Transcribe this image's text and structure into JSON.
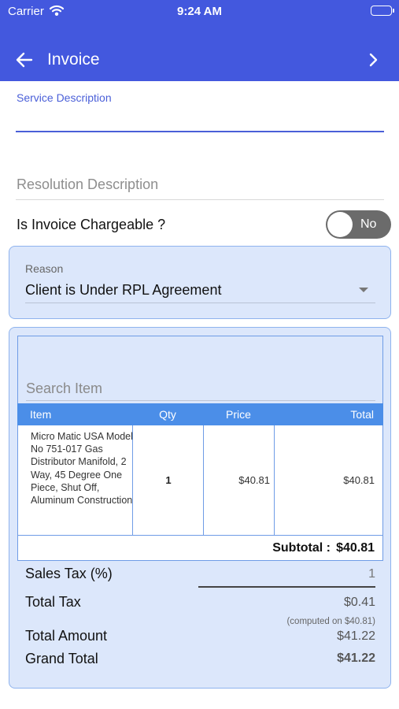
{
  "status": {
    "carrier": "Carrier",
    "time": "9:24 AM"
  },
  "header": {
    "title": "Invoice"
  },
  "service": {
    "label": "Service Description",
    "value": ""
  },
  "resolution": {
    "placeholder": "Resolution Description"
  },
  "chargeable": {
    "label": "Is Invoice Chargeable ?",
    "toggle_text": "No",
    "on": false
  },
  "reason": {
    "label": "Reason",
    "value": "Client is Under RPL Agreement"
  },
  "search": {
    "placeholder": "Search Item"
  },
  "table": {
    "headers": [
      "Item",
      "Qty",
      "Price",
      "Total"
    ],
    "rows": [
      {
        "item": "Micro Matic USA Model No 751-017 Gas Distributor Manifold, 2 Way, 45 Degree One Piece, Shut Off, Aluminum Construction",
        "qty": "1",
        "price": "$40.81",
        "total": "$40.81"
      }
    ],
    "subtotal_label": "Subtotal  :",
    "subtotal_value": "$40.81"
  },
  "summary": {
    "sales_tax_label": "Sales Tax (%)",
    "sales_tax_value": "1",
    "total_tax_label": "Total Tax",
    "total_tax_value": "$0.41",
    "computed_note": "(computed on $40.81)",
    "total_amount_label": "Total Amount",
    "total_amount_value": "$41.22",
    "grand_total_label": "Grand Total",
    "grand_total_value": "$41.22"
  },
  "colors": {
    "header_bg": "#4358de",
    "accent": "#4a5fd8",
    "table_header": "#4b8ee8",
    "panel_bg": "#dce7fb",
    "toggle_off": "#6b6b6b"
  }
}
